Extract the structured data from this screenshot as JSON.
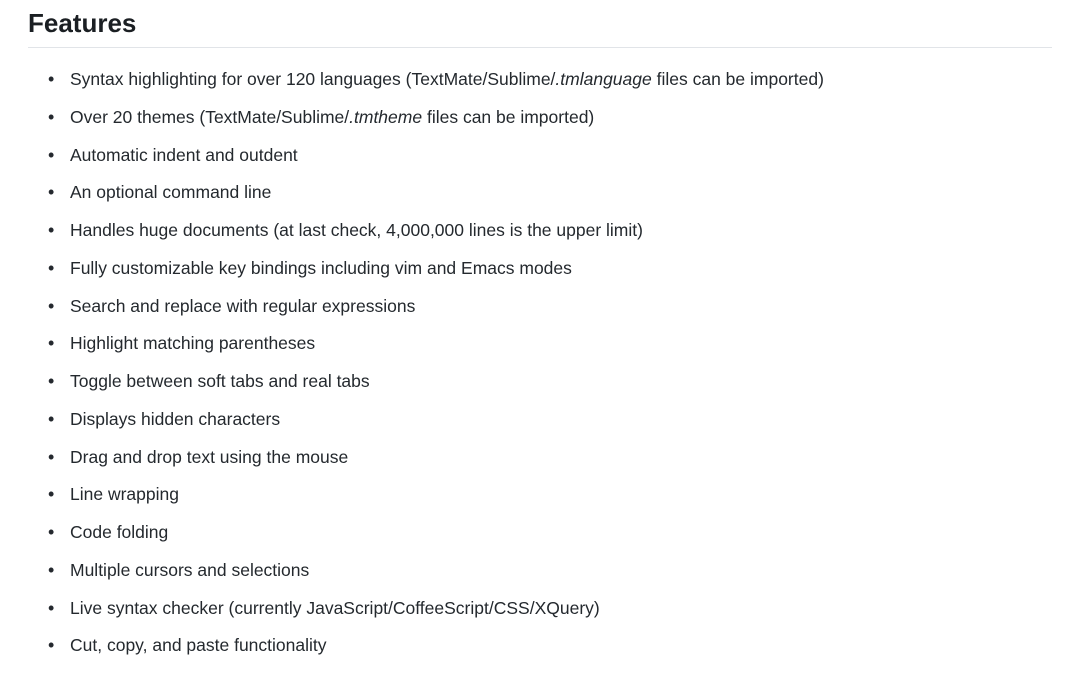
{
  "section": {
    "heading": "Features",
    "items": [
      {
        "parts": [
          {
            "text": "Syntax highlighting for over 120 languages (TextMate/Sublime/",
            "italic": false
          },
          {
            "text": ".tmlanguage",
            "italic": true
          },
          {
            "text": " files can be imported)",
            "italic": false
          }
        ]
      },
      {
        "parts": [
          {
            "text": "Over 20 themes (TextMate/Sublime/",
            "italic": false
          },
          {
            "text": ".tmtheme",
            "italic": true
          },
          {
            "text": " files can be imported)",
            "italic": false
          }
        ]
      },
      {
        "parts": [
          {
            "text": "Automatic indent and outdent",
            "italic": false
          }
        ]
      },
      {
        "parts": [
          {
            "text": "An optional command line",
            "italic": false
          }
        ]
      },
      {
        "parts": [
          {
            "text": "Handles huge documents (at last check, 4,000,000 lines is the upper limit)",
            "italic": false
          }
        ]
      },
      {
        "parts": [
          {
            "text": "Fully customizable key bindings including vim and Emacs modes",
            "italic": false
          }
        ]
      },
      {
        "parts": [
          {
            "text": "Search and replace with regular expressions",
            "italic": false
          }
        ]
      },
      {
        "parts": [
          {
            "text": "Highlight matching parentheses",
            "italic": false
          }
        ]
      },
      {
        "parts": [
          {
            "text": "Toggle between soft tabs and real tabs",
            "italic": false
          }
        ]
      },
      {
        "parts": [
          {
            "text": "Displays hidden characters",
            "italic": false
          }
        ]
      },
      {
        "parts": [
          {
            "text": "Drag and drop text using the mouse",
            "italic": false
          }
        ]
      },
      {
        "parts": [
          {
            "text": "Line wrapping",
            "italic": false
          }
        ]
      },
      {
        "parts": [
          {
            "text": "Code folding",
            "italic": false
          }
        ]
      },
      {
        "parts": [
          {
            "text": "Multiple cursors and selections",
            "italic": false
          }
        ]
      },
      {
        "parts": [
          {
            "text": "Live syntax checker (currently JavaScript/CoffeeScript/CSS/XQuery)",
            "italic": false
          }
        ]
      },
      {
        "parts": [
          {
            "text": "Cut, copy, and paste functionality",
            "italic": false
          }
        ]
      }
    ]
  }
}
